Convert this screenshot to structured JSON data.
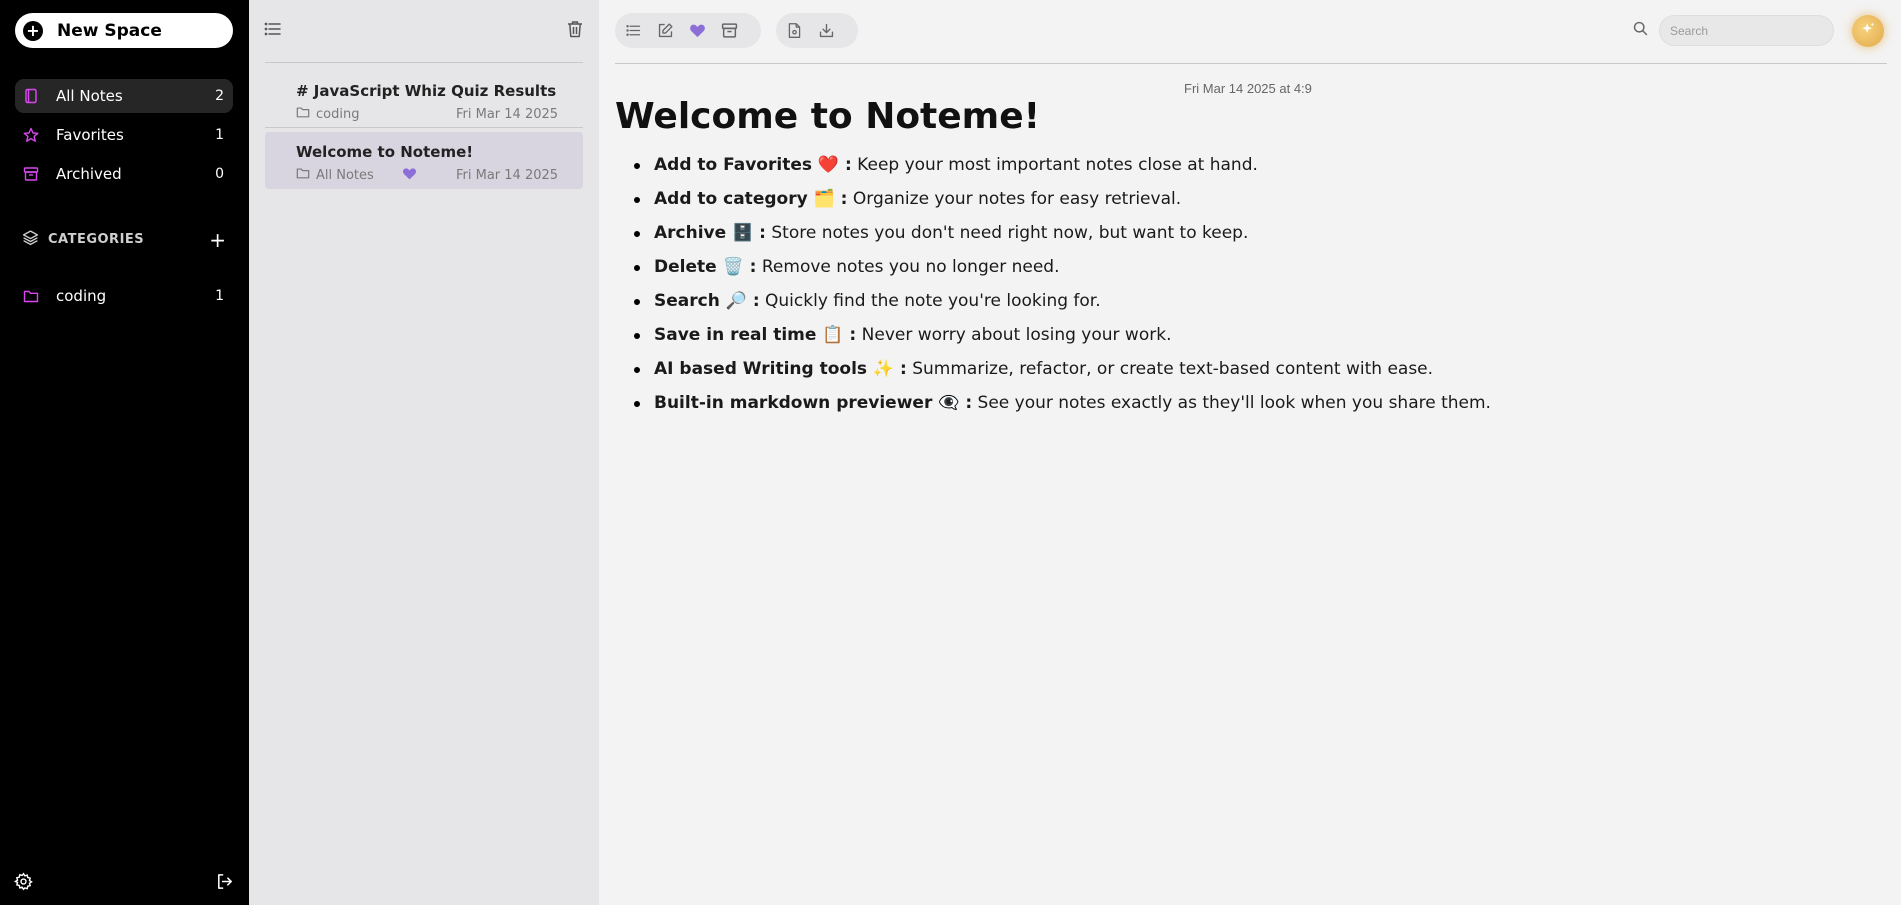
{
  "sidebar": {
    "new_space_label": "New Space",
    "nav": [
      {
        "label": "All Notes",
        "count": "2"
      },
      {
        "label": "Favorites",
        "count": "1"
      },
      {
        "label": "Archived",
        "count": "0"
      }
    ],
    "categories_header": "CATEGORIES",
    "categories": [
      {
        "label": "coding",
        "count": "1"
      }
    ],
    "accent_color": "#d946ef"
  },
  "notes": [
    {
      "title": "# JavaScript Whiz Quiz Results",
      "category": "coding",
      "date": "Fri Mar 14 2025",
      "favorite": false
    },
    {
      "title": "Welcome to Noteme!",
      "category": "All Notes",
      "date": "Fri Mar 14 2025",
      "favorite": true
    }
  ],
  "editor": {
    "search_placeholder": "Search",
    "timestamp": "Fri Mar 14 2025 at 4:9",
    "title": "Welcome to Noteme!",
    "features": [
      {
        "bold": "Add to Favorites ❤️ :",
        "text": " Keep your most important notes close at hand."
      },
      {
        "bold": "Add to category 🗂️ :",
        "text": " Organize your notes for easy retrieval."
      },
      {
        "bold": "Archive 🗄️ :",
        "text": " Store notes you don't need right now, but want to keep."
      },
      {
        "bold": "Delete 🗑️ :",
        "text": " Remove notes you no longer need."
      },
      {
        "bold": "Search 🔎 :",
        "text": " Quickly find the note you're looking for."
      },
      {
        "bold": "Save in real time 📋 :",
        "text": " Never worry about losing your work."
      },
      {
        "bold": "AI based Writing tools ✨ :",
        "text": " Summarize, refactor, or create text-based content with ease."
      },
      {
        "bold": "Built-in markdown previewer 👁️‍🗨️ :",
        "text": " See your notes exactly as they'll look when you share them."
      }
    ]
  }
}
